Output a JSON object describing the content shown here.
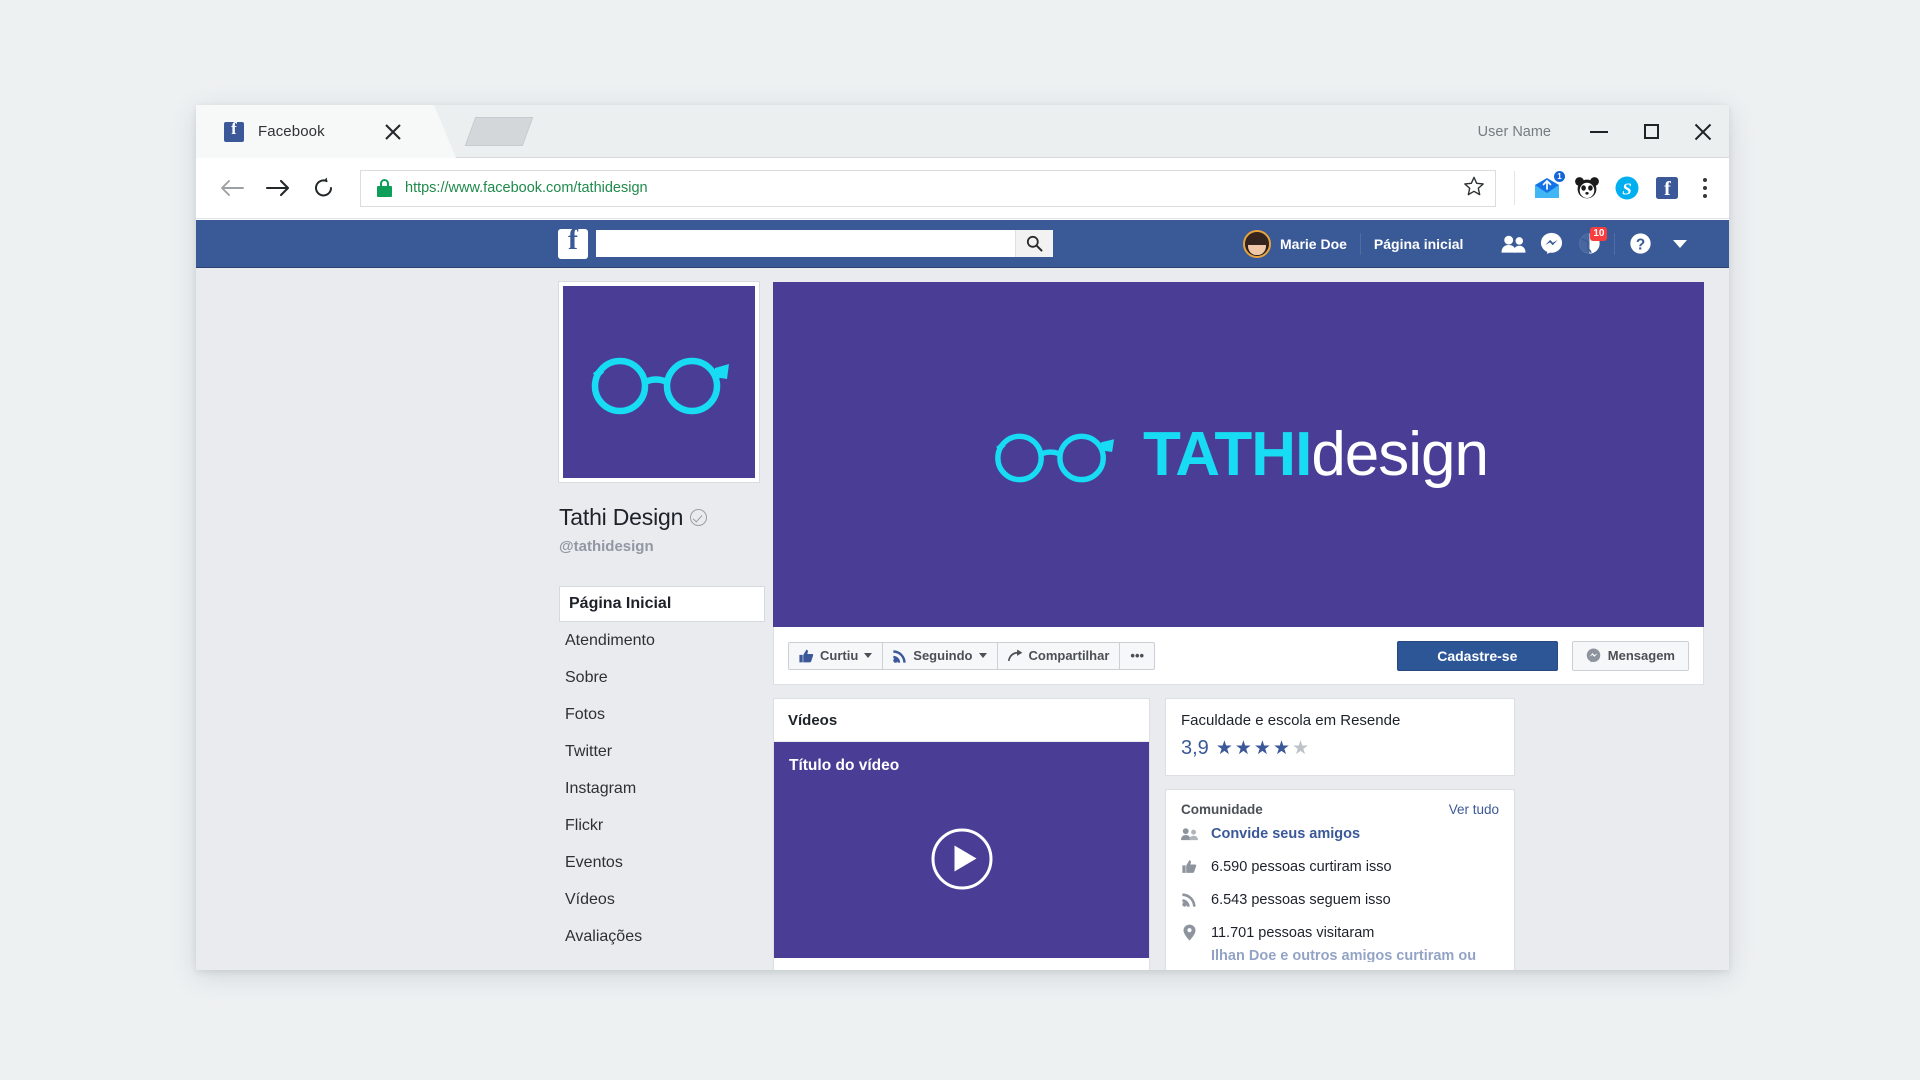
{
  "browser": {
    "tab": {
      "title": "Facebook",
      "favicon": "facebook-favicon",
      "close_icon": "close-icon"
    },
    "new_tab_button": "new-tab-button",
    "user_name": "User Name",
    "window_controls": {
      "minimize": "minimize-icon",
      "maximize": "maximize-icon",
      "close": "close-icon"
    },
    "nav": {
      "back": "back-arrow-icon",
      "forward": "forward-arrow-icon",
      "reload": "reload-icon"
    },
    "omnibox": {
      "url": "https://www.facebook.com/tathidesign",
      "secure_icon": "lock-icon",
      "secure_color": "#1f8a4c",
      "bookmark_icon": "star-icon"
    },
    "extensions": [
      {
        "name": "mail-extension-icon",
        "badge": "1"
      },
      {
        "name": "panda-extension-icon",
        "badge": ""
      },
      {
        "name": "skype-extension-icon",
        "badge": ""
      },
      {
        "name": "facebook-extension-icon",
        "badge": ""
      }
    ],
    "menu_icon": "chrome-menu-icon"
  },
  "facebook": {
    "topbar": {
      "logo": "facebook-logo",
      "search_placeholder": "",
      "search_value": "",
      "search_icon": "search-icon",
      "user_name": "Marie Doe",
      "home_link": "Página inicial",
      "icons": [
        {
          "name": "friend-requests-icon",
          "badge": ""
        },
        {
          "name": "messenger-icon",
          "badge": ""
        },
        {
          "name": "notifications-globe-icon",
          "badge": "10"
        },
        {
          "name": "help-icon",
          "badge": ""
        }
      ],
      "caret": "chevron-down-icon",
      "badge_color": "#fa3e3e",
      "bar_color": "#3a5a97"
    },
    "profile": {
      "picture_icon": "glasses-logo",
      "name": "Tathi Design",
      "verified": true,
      "handle": "@tathidesign"
    },
    "sidebar": {
      "items": [
        {
          "label": "Página Inicial",
          "active": true
        },
        {
          "label": "Atendimento",
          "active": false
        },
        {
          "label": "Sobre",
          "active": false
        },
        {
          "label": "Fotos",
          "active": false
        },
        {
          "label": "Twitter",
          "active": false
        },
        {
          "label": "Instagram",
          "active": false
        },
        {
          "label": "Flickr",
          "active": false
        },
        {
          "label": "Eventos",
          "active": false
        },
        {
          "label": "Vídeos",
          "active": false
        },
        {
          "label": "Avaliações",
          "active": false
        }
      ]
    },
    "cover": {
      "brand_bold": "TATHI",
      "brand_light": "design",
      "background_color": "#4a3d96",
      "accent_color": "#17dcf3",
      "glasses_icon": "glasses-icon"
    },
    "actions": {
      "like": {
        "label": "Curtiu",
        "icon": "thumbs-up-icon",
        "caret": true
      },
      "follow": {
        "label": "Seguindo",
        "icon": "rss-icon",
        "caret": true
      },
      "share": {
        "label": "Compartilhar",
        "icon": "share-arrow-icon"
      },
      "more": {
        "label": "•••",
        "icon": "more-options-icon"
      },
      "signup": "Cadastre-se",
      "message": {
        "label": "Mensagem",
        "icon": "messenger-icon"
      }
    },
    "videos": {
      "header": "Vídeos",
      "video_title": "Título do vídeo",
      "play_icon": "play-icon"
    },
    "rating_card": {
      "title": "Faculdade e escola em Resende",
      "value": "3,9",
      "stars_filled": 4,
      "stars_total": 5,
      "star_color": "#3b5998"
    },
    "community_card": {
      "title": "Comunidade",
      "see_all": "Ver tudo",
      "rows": [
        {
          "icon": "invite-friends-icon",
          "text": "Convide seus amigos",
          "link": true
        },
        {
          "icon": "thumbs-up-icon",
          "text": "6.590 pessoas curtiram isso",
          "link": false
        },
        {
          "icon": "rss-icon",
          "text": "6.543 pessoas seguem isso",
          "link": false
        },
        {
          "icon": "location-pin-icon",
          "text": "11.701 pessoas visitaram",
          "link": false
        },
        {
          "icon": "friends-icon",
          "text": "Ilhan Doe e outros amigos curtiram ou",
          "link": true
        }
      ]
    }
  }
}
